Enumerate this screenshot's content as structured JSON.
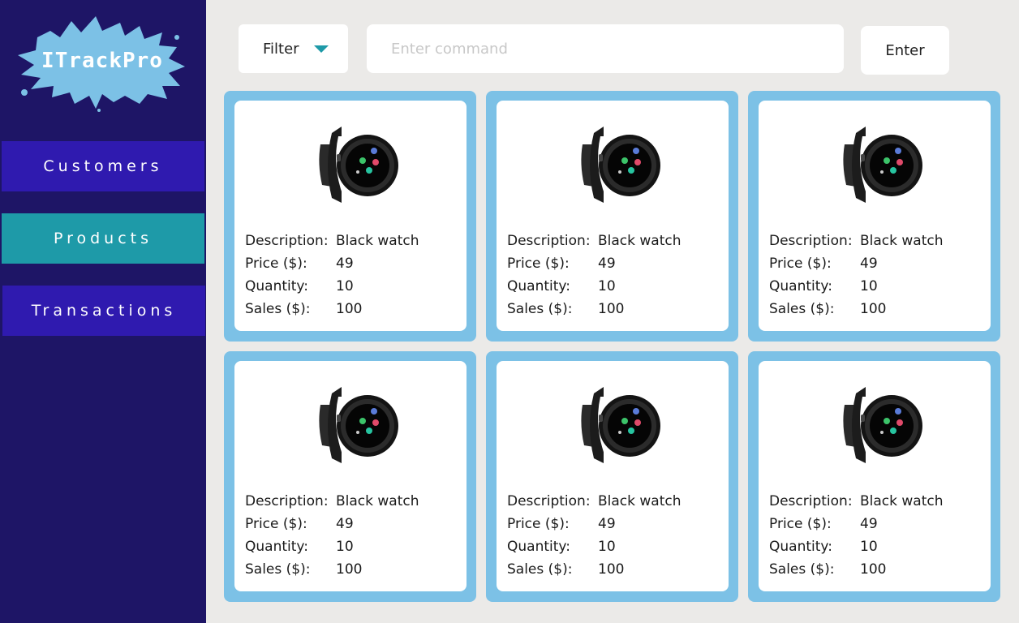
{
  "app": {
    "logo_text": "ITrackPro",
    "colors": {
      "sidebar": "#1e1566",
      "nav_button": "#2f1aaf",
      "nav_active": "#1e9aa8",
      "card_frame": "#7cc1e6",
      "background": "#ebeae8"
    }
  },
  "sidebar": {
    "items": [
      {
        "label": "Customers",
        "active": false
      },
      {
        "label": "Products",
        "active": true
      },
      {
        "label": "Transactions",
        "active": false
      }
    ]
  },
  "toolbar": {
    "filter_label": "Filter",
    "filter_icon": "caret-down-icon",
    "command_placeholder": "Enter command",
    "command_value": "",
    "enter_label": "Enter"
  },
  "labels": {
    "description": "Description:",
    "price": "Price ($):",
    "quantity": "Quantity:",
    "sales": "Sales ($):"
  },
  "products": [
    {
      "image": "smartwatch-image",
      "description": "Black watch",
      "price": "49",
      "quantity": "10",
      "sales": "100"
    },
    {
      "image": "smartwatch-image",
      "description": "Black watch",
      "price": "49",
      "quantity": "10",
      "sales": "100"
    },
    {
      "image": "smartwatch-image",
      "description": "Black watch",
      "price": "49",
      "quantity": "10",
      "sales": "100"
    },
    {
      "image": "smartwatch-image",
      "description": "Black watch",
      "price": "49",
      "quantity": "10",
      "sales": "100"
    },
    {
      "image": "smartwatch-image",
      "description": "Black watch",
      "price": "49",
      "quantity": "10",
      "sales": "100"
    },
    {
      "image": "smartwatch-image",
      "description": "Black watch",
      "price": "49",
      "quantity": "10",
      "sales": "100"
    }
  ]
}
